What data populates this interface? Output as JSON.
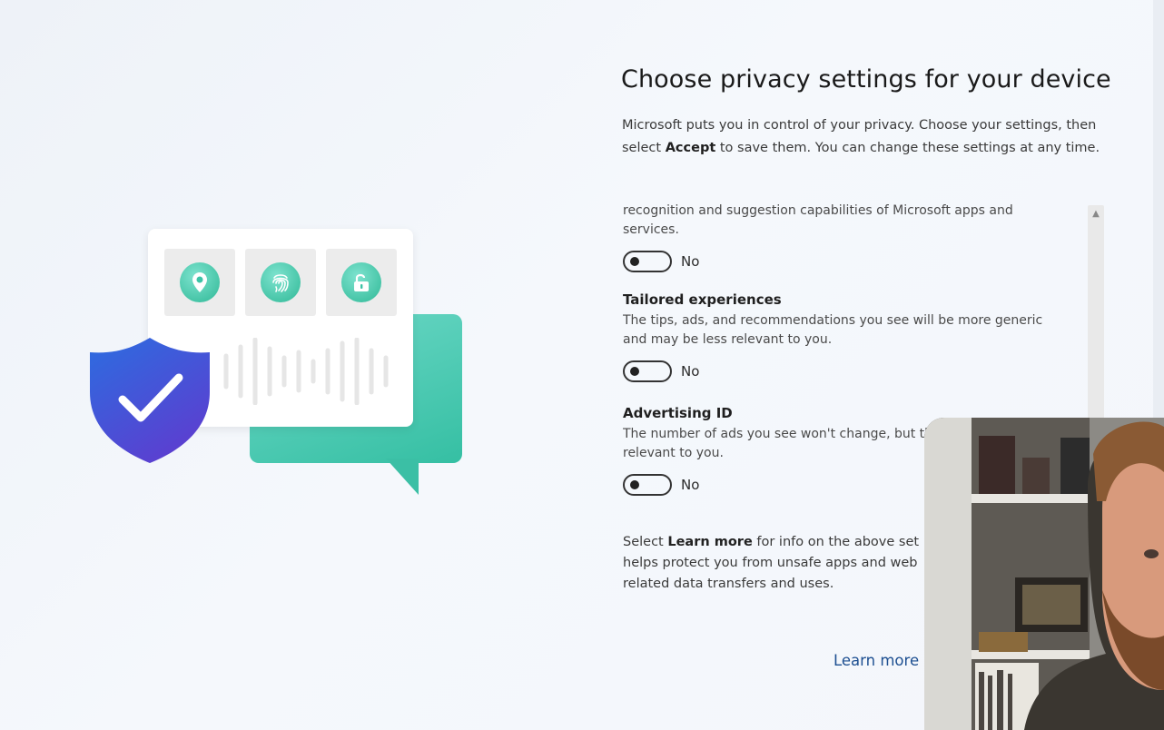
{
  "page": {
    "title": "Choose privacy settings for your device",
    "intro_part1": "Microsoft puts you in control of your privacy. Choose your settings, then select ",
    "intro_bold": "Accept",
    "intro_part2": " to save them. You can change these settings at any time."
  },
  "settings": {
    "partial_desc": "recognition and suggestion capabilities of Microsoft apps and services.",
    "partial_toggle_label": "No",
    "tailored": {
      "title": "Tailored experiences",
      "desc": "The tips, ads, and recommendations you see will be more generic and may be less relevant to you.",
      "toggle_label": "No"
    },
    "advertising": {
      "title": "Advertising ID",
      "desc": "The number of ads you see won't change, but th",
      "desc2": "relevant to you.",
      "toggle_label": "No"
    }
  },
  "footer": {
    "part1": "Select ",
    "bold": "Learn more",
    "part2": " for info on the above set",
    "line2": "helps protect you from unsafe apps and web",
    "line3": "related data transfers and uses.",
    "learn_more": "Learn more"
  },
  "colors": {
    "accent_teal": "#35bfa3",
    "shield_blue": "#3458d8",
    "link": "#1d4f91"
  },
  "icons": [
    "location-pin-icon",
    "fingerprint-icon",
    "unlock-icon",
    "shield-check-icon",
    "chevron-up-icon"
  ]
}
